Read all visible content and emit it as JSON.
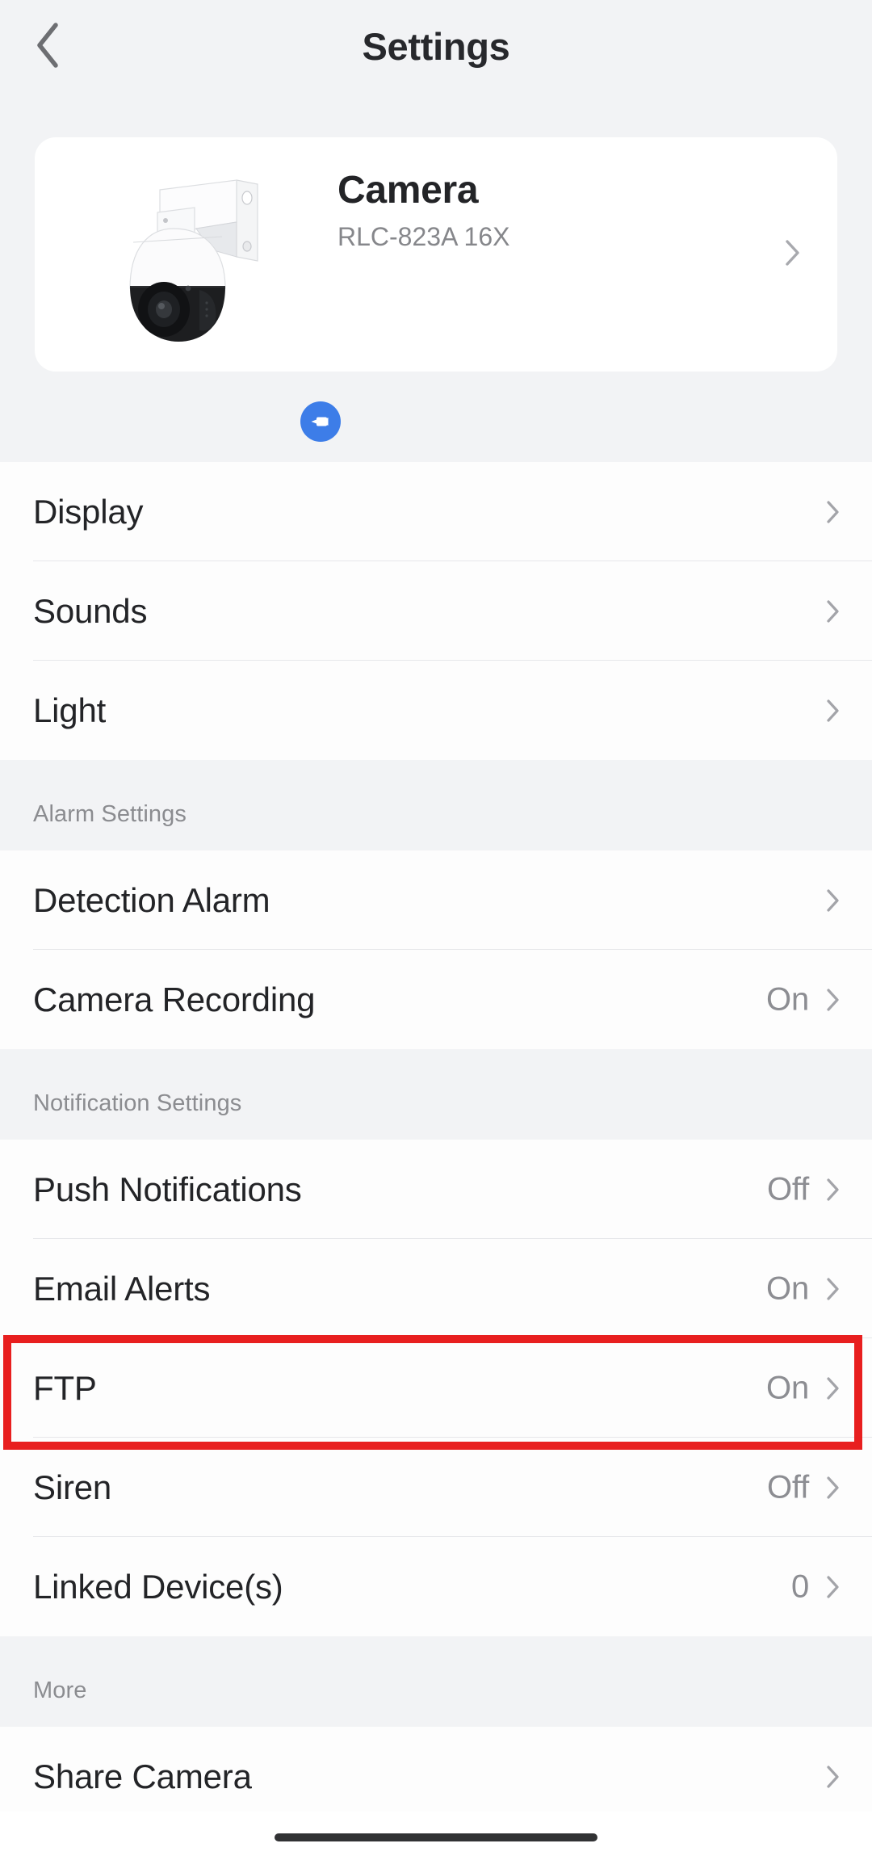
{
  "app": {
    "title": "Settings",
    "back_icon": "chevron-left-icon"
  },
  "device_card": {
    "name": "Camera",
    "model": "RLC-823A 16X",
    "thumbnail_icon": "ptz-dome-camera-image",
    "status_badge_icon": "power-plug-icon",
    "status_badge_color": "#3d7de8",
    "chevron_icon": "chevron-right-icon"
  },
  "sections": [
    {
      "header": "",
      "rows": [
        {
          "label": "Display",
          "value": "",
          "chevron": "chevron-right-icon"
        },
        {
          "label": "Sounds",
          "value": "",
          "chevron": "chevron-right-icon"
        },
        {
          "label": "Light",
          "value": "",
          "chevron": "chevron-right-icon"
        }
      ]
    },
    {
      "header": "Alarm Settings",
      "rows": [
        {
          "label": "Detection Alarm",
          "value": "",
          "chevron": "chevron-right-icon"
        },
        {
          "label": "Camera Recording",
          "value": "On",
          "chevron": "chevron-right-icon"
        }
      ]
    },
    {
      "header": "Notification Settings",
      "rows": [
        {
          "label": "Push Notifications",
          "value": "Off",
          "chevron": "chevron-right-icon"
        },
        {
          "label": "Email Alerts",
          "value": "On",
          "chevron": "chevron-right-icon"
        },
        {
          "label": "FTP",
          "value": "On",
          "chevron": "chevron-right-icon"
        },
        {
          "label": "Siren",
          "value": "Off",
          "chevron": "chevron-right-icon"
        },
        {
          "label": "Linked Device(s)",
          "value": "0",
          "chevron": "chevron-right-icon"
        }
      ]
    },
    {
      "header": "More",
      "rows": [
        {
          "label": "Share Camera",
          "value": "",
          "chevron": "chevron-right-icon"
        }
      ]
    }
  ],
  "annotation": {
    "target_label": "FTP",
    "border_color": "#e81f1f"
  },
  "system": {
    "home_indicator": "home-indicator-bar"
  }
}
